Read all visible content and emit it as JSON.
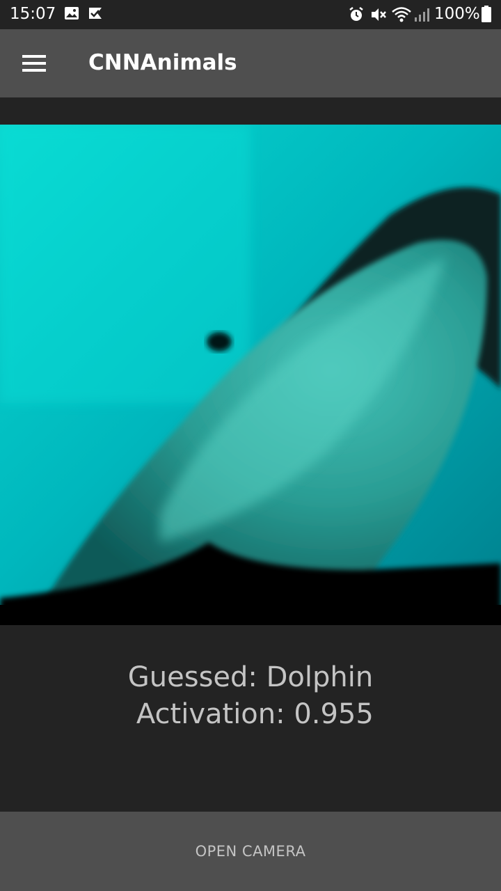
{
  "status_bar": {
    "time": "15:07",
    "battery": "100%",
    "left_icons": [
      "image-icon",
      "check-flag-icon"
    ],
    "right_icons": [
      "alarm-icon",
      "mute-icon",
      "wifi-icon",
      "signal-icon",
      "battery-icon"
    ]
  },
  "app_bar": {
    "title": "CNNAnimals",
    "menu_icon": "hamburger-menu-icon",
    "background": "#4f4f4f"
  },
  "photo": {
    "subject": "dolphin",
    "colors": {
      "water": "#00c4c7",
      "animal": "#2b8e8a",
      "shadow": "#050a0a"
    }
  },
  "result": {
    "guessed_line": "Guessed: Dolphin",
    "activation_line": " Activation: 0.955",
    "text_color": "#c4c4c4"
  },
  "bottom_bar": {
    "button_label": "OPEN CAMERA"
  }
}
